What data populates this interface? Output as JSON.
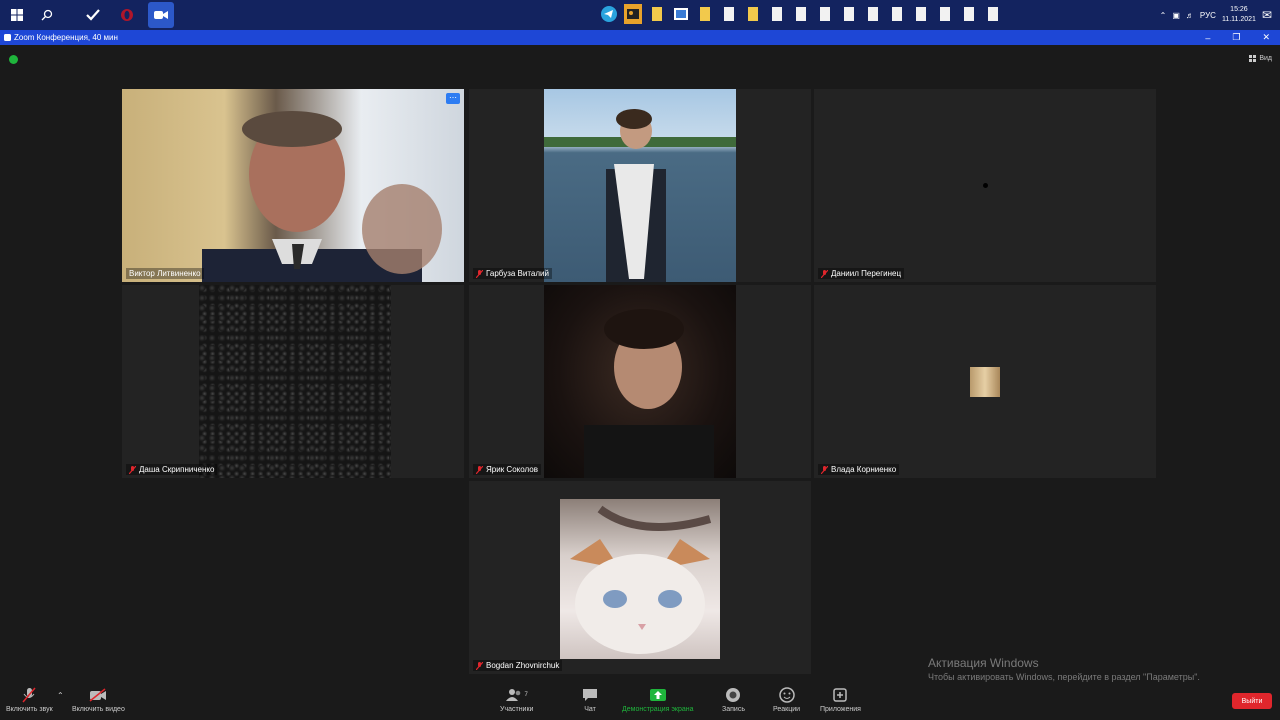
{
  "taskbar": {
    "lang": "РУС",
    "time": "15:26",
    "date": "11.11.2021"
  },
  "window": {
    "title": "Zoom Конференция, 40 мин"
  },
  "meeting": {
    "view_label": "Вид",
    "participants": [
      {
        "name": "Виктор Литвиненко",
        "muted": false,
        "active": true
      },
      {
        "name": "Гарбуза Виталий",
        "muted": true
      },
      {
        "name": "Даниил Перегинец",
        "muted": true
      },
      {
        "name": "Даша Скрипниченко",
        "muted": true
      },
      {
        "name": "Ярик Соколов",
        "muted": true
      },
      {
        "name": "Влада Корниенко",
        "muted": true
      },
      {
        "name": "Bogdan Zhovnirchuk",
        "muted": true
      }
    ]
  },
  "toolbar": {
    "audio": "Включить звук",
    "video": "Включить видео",
    "participants": "Участники",
    "participants_count": "7",
    "chat": "Чат",
    "share": "Демонстрация экрана",
    "record": "Запись",
    "reactions": "Реакции",
    "apps": "Приложения",
    "leave": "Выйти"
  },
  "watermark": {
    "line1": "Активация Windows",
    "line2": "Чтобы активировать Windows, перейдите в раздел \"Параметры\"."
  },
  "colors": {
    "active_speaker_border": "#c9d94a",
    "leave": "#e0262c",
    "share": "#1fb53c",
    "taskbar": "#13235f",
    "titlebar": "#1e47d6"
  }
}
